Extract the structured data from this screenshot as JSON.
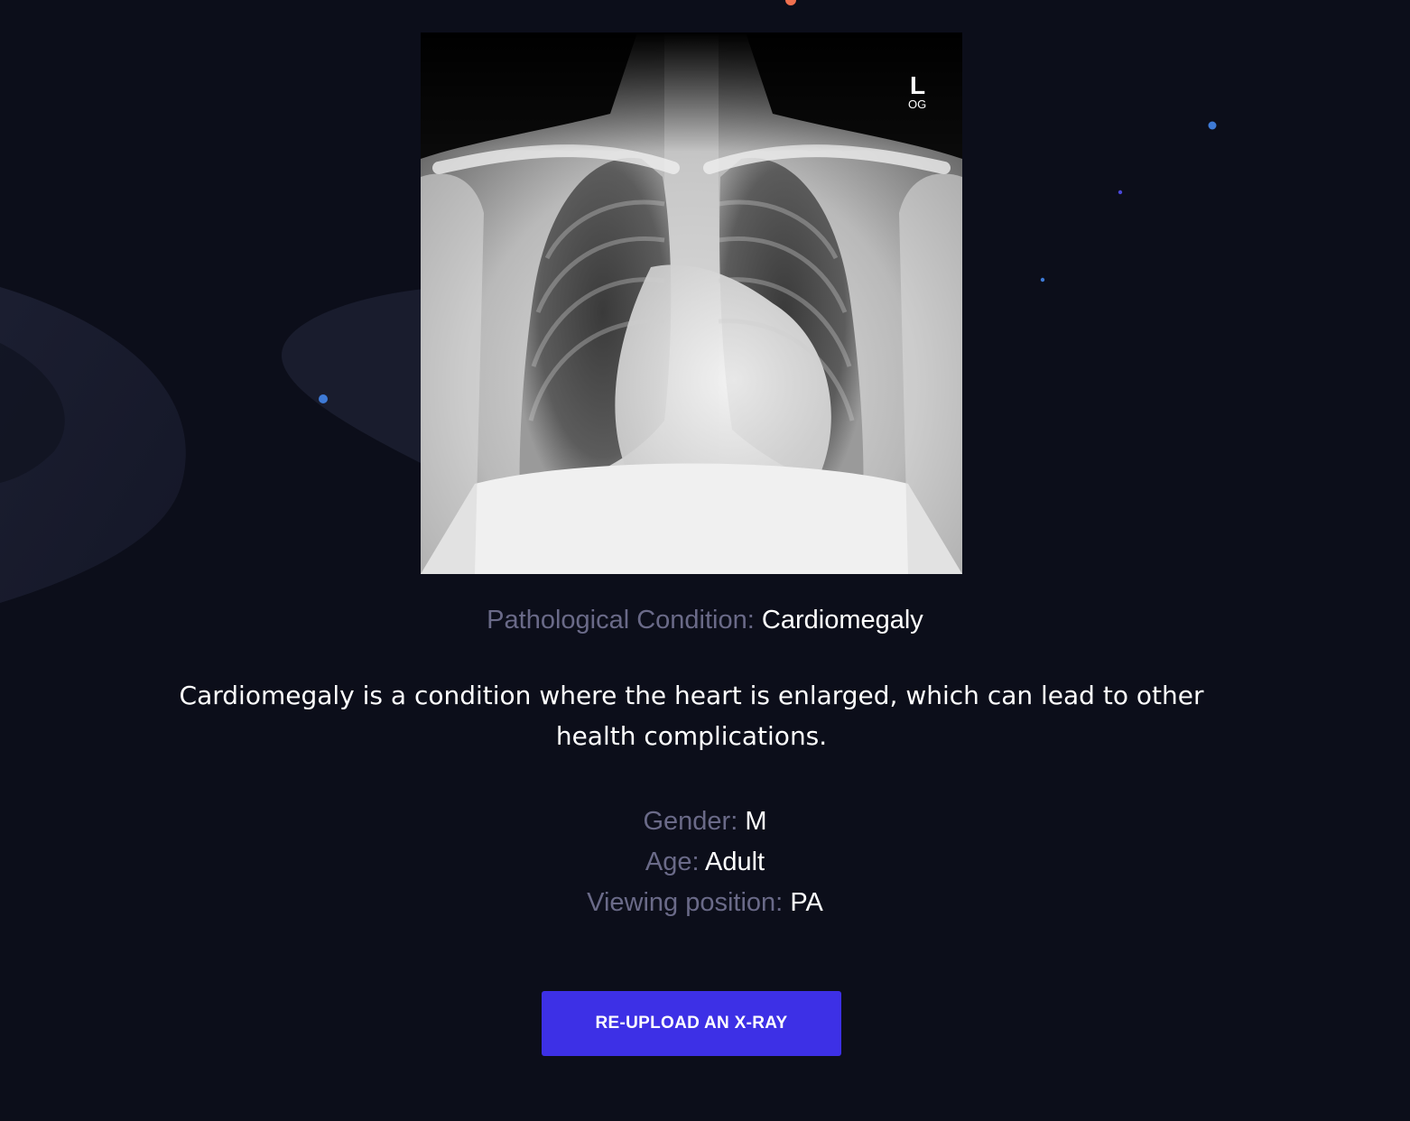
{
  "colors": {
    "background": "#0c0e1a",
    "muted_text": "#6a6a88",
    "primary_button": "#3d30e6",
    "accent_dot_orange": "#f0704f",
    "accent_dot_blue": "#3e7ad6"
  },
  "result": {
    "condition_label": "Pathological Condition:",
    "condition_value": "Cardiomegaly",
    "description": "Cardiomegaly is a condition where the heart is enlarged, which can lead to other health complications."
  },
  "patient": {
    "gender_label": "Gender:",
    "gender_value": "M",
    "age_label": "Age:",
    "age_value": "Adult",
    "position_label": "Viewing position:",
    "position_value": "PA"
  },
  "xray": {
    "marker_text": "L",
    "marker_subtext": "OG"
  },
  "actions": {
    "reupload_label": "RE-UPLOAD AN X-RAY"
  }
}
